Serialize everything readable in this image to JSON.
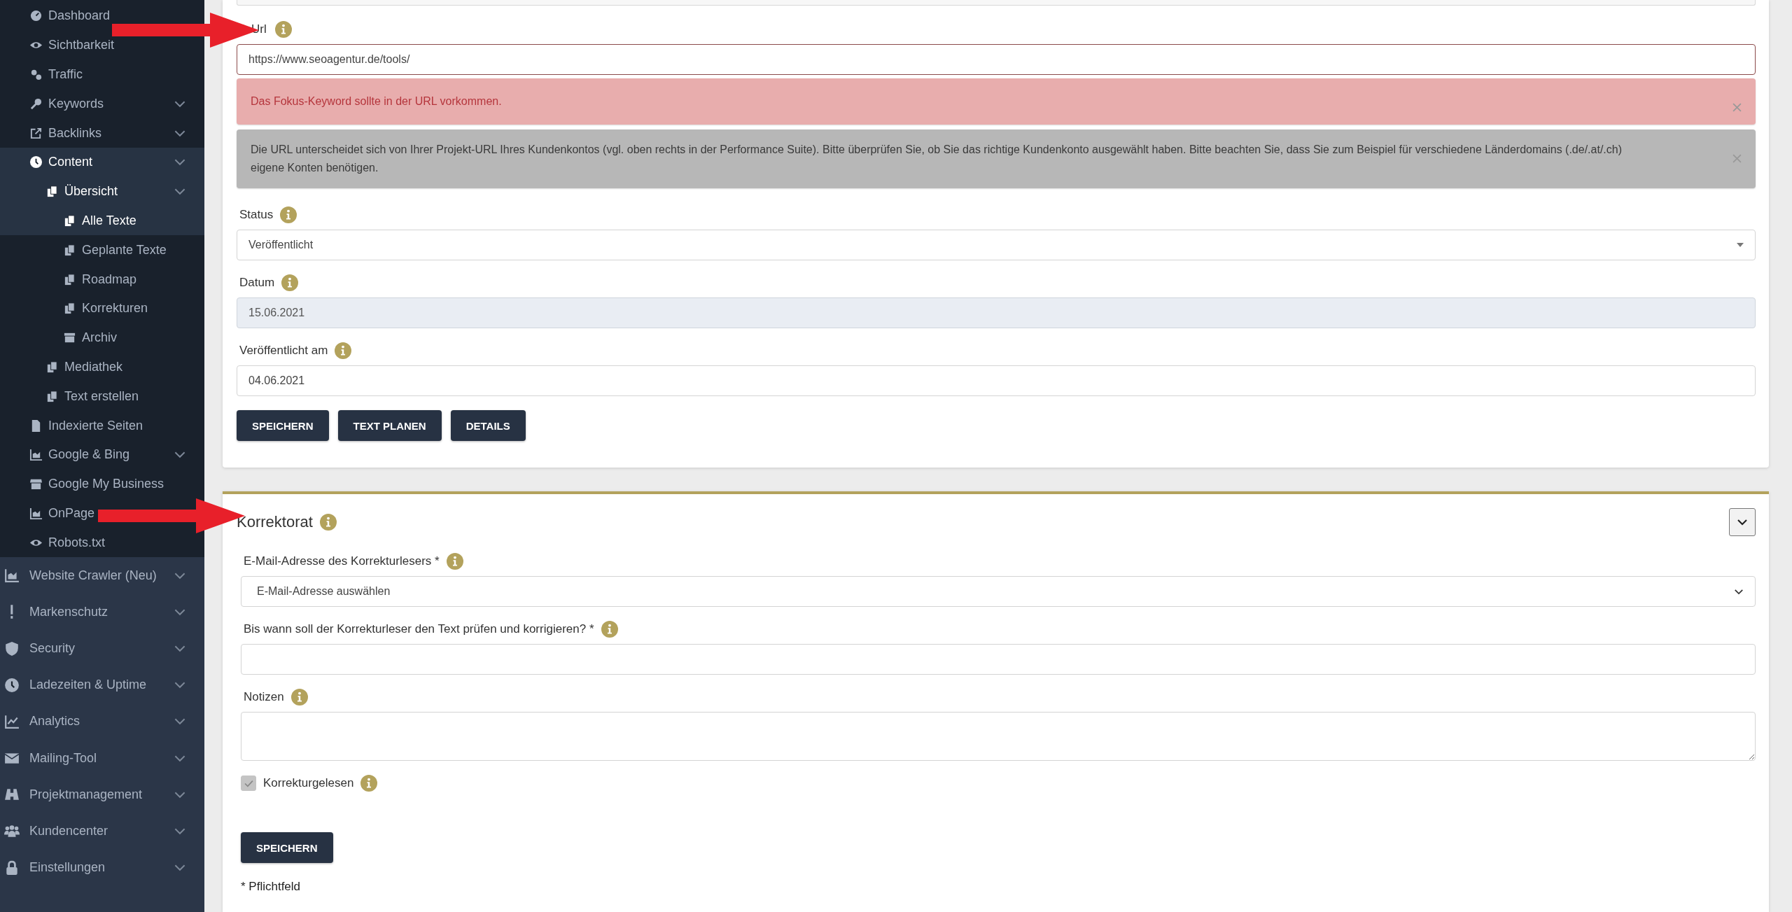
{
  "sidebar": {
    "groups": [
      {
        "items": [
          {
            "label": "Dashboard",
            "submenu": false,
            "selected": false
          },
          {
            "label": "Sichtbarkeit",
            "submenu": false,
            "selected": false
          },
          {
            "label": "Traffic",
            "submenu": false,
            "selected": false
          },
          {
            "label": "Keywords",
            "submenu": true,
            "selected": false
          },
          {
            "label": "Backlinks",
            "submenu": true,
            "selected": false
          },
          {
            "label": "Content",
            "submenu": true,
            "selected": true,
            "children": [
              {
                "label": "Übersicht",
                "submenu": true,
                "selected": true,
                "children": [
                  {
                    "label": "Alle Texte",
                    "submenu": false,
                    "selected": true
                  },
                  {
                    "label": "Geplante Texte",
                    "submenu": false,
                    "selected": false
                  },
                  {
                    "label": "Roadmap",
                    "submenu": false,
                    "selected": false
                  },
                  {
                    "label": "Korrekturen",
                    "submenu": false,
                    "selected": false
                  },
                  {
                    "label": "Archiv",
                    "submenu": false,
                    "selected": false
                  }
                ]
              },
              {
                "label": "Mediathek",
                "submenu": false,
                "selected": false
              },
              {
                "label": "Text erstellen",
                "submenu": false,
                "selected": false
              }
            ]
          },
          {
            "label": "Indexierte Seiten",
            "submenu": false,
            "selected": false
          },
          {
            "label": "Google & Bing",
            "submenu": true,
            "selected": false
          },
          {
            "label": "Google My Business",
            "submenu": false,
            "selected": false
          },
          {
            "label": "OnPage",
            "submenu": false,
            "selected": false
          },
          {
            "label": "Robots.txt",
            "submenu": false,
            "selected": false
          }
        ]
      },
      {
        "items": [
          {
            "label": "Website Crawler (Neu)",
            "submenu": true,
            "selected": false
          },
          {
            "label": "Markenschutz",
            "submenu": true,
            "selected": false
          },
          {
            "label": "Security",
            "submenu": true,
            "selected": false
          },
          {
            "label": "Ladezeiten & Uptime",
            "submenu": true,
            "selected": false
          },
          {
            "label": "Analytics",
            "submenu": true,
            "selected": false
          },
          {
            "label": "Mailing-Tool",
            "submenu": true,
            "selected": false
          },
          {
            "label": "Projektmanagement",
            "submenu": true,
            "selected": false
          },
          {
            "label": "Kundencenter",
            "submenu": true,
            "selected": false
          },
          {
            "label": "Einstellungen",
            "submenu": true,
            "selected": false
          }
        ]
      }
    ]
  },
  "content_card": {
    "url_field": {
      "label": "Url",
      "value": "https://www.seoagentur.de/tools/",
      "alerts": [
        {
          "kind": "danger",
          "text": "Das Fokus-Keyword sollte in der URL vorkommen."
        },
        {
          "kind": "secondary",
          "text": "Die URL unterscheidet sich von Ihrer Projekt-URL Ihres Kundenkontos (vgl. oben rechts in der Performance Suite). Bitte überprüfen Sie, ob Sie das richtige Kundenkonto ausgewählt haben. Bitte beachten Sie, dass Sie zum Beispiel für verschiedene Länderdomains (.de/.at/.ch) eigene Konten benötigen."
        }
      ]
    },
    "fields": [
      {
        "label": "Status",
        "kind": "select",
        "value": "Veröffentlicht",
        "disabled": false
      },
      {
        "label": "Datum",
        "kind": "input",
        "value": "15.06.2021",
        "disabled": true
      },
      {
        "label": "Veröffentlicht am",
        "kind": "input",
        "value": "04.06.2021",
        "disabled": false
      }
    ],
    "buttons": [
      "SPEICHERN",
      "TEXT PLANEN",
      "DETAILS"
    ]
  },
  "proofreading": {
    "title": "Korrektorat",
    "fields": [
      {
        "label": "E-Mail-Adresse des Korrekturlesers *",
        "kind": "dropdown",
        "value": "E-Mail-Adresse auswählen"
      },
      {
        "label": "Bis wann soll der Korrekturleser den Text prüfen und korrigieren? *",
        "kind": "input"
      },
      {
        "label": "Notizen",
        "kind": "textarea"
      }
    ],
    "checkbox": {
      "label": "Korrekturgelesen",
      "checked": true,
      "disabled": true
    },
    "button": "SPEICHERN",
    "footnote": "* Pflichtfeld"
  }
}
